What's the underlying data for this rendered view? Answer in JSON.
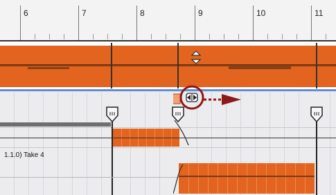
{
  "ruler": {
    "bars": [
      "6",
      "7",
      "8",
      "9",
      "10",
      "11"
    ]
  },
  "tracks": {
    "take_label": "1.1.0) Take 4"
  },
  "colors": {
    "region": "#e2641e",
    "playlist_line": "#5d8fd8",
    "highlight_circle": "#8b1a1a",
    "arrow": "#8b1a1a"
  },
  "icons": {
    "resize_handle": "diamond-resize-icon",
    "crossfade_handle": "crossfade-handle-icon",
    "marker": "comping-marker-icon",
    "drag_arrow": "right-arrow-icon"
  }
}
